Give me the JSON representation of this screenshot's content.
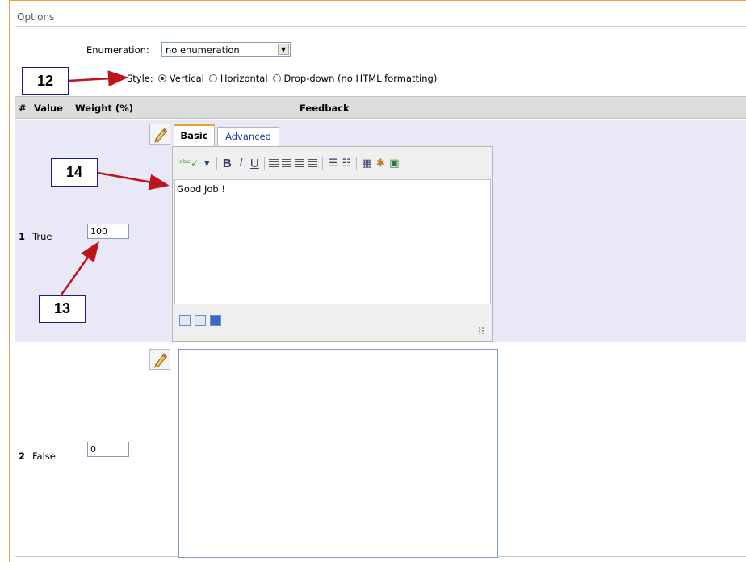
{
  "options": {
    "title": "Options",
    "enumeration_label": "Enumeration:",
    "enumeration_value": "no enumeration",
    "style_label": "Style:",
    "style_options": [
      "Vertical",
      "Horizontal",
      "Drop-down (no HTML formatting)"
    ],
    "style_selected": "Vertical"
  },
  "table": {
    "headers": {
      "num": "#",
      "value": "Value",
      "weight": "Weight (%)",
      "feedback": "Feedback"
    },
    "rows": [
      {
        "num": "1",
        "value": "True",
        "weight": "100",
        "feedback": "Good Job !"
      },
      {
        "num": "2",
        "value": "False",
        "weight": "0",
        "feedback": ""
      }
    ]
  },
  "editor": {
    "tabs": [
      "Basic",
      "Advanced"
    ],
    "active_tab": "Basic",
    "toolbar_icons": [
      "spellcheck-icon",
      "bold-icon",
      "italic-icon",
      "underline-icon",
      "align-left-icon",
      "align-center-icon",
      "align-right-icon",
      "align-justify-icon",
      "bullet-list-icon",
      "numbered-list-icon",
      "table-icon",
      "link-icon",
      "image-icon"
    ],
    "bottom_icons": [
      "new-document-icon",
      "preview-icon",
      "fullscreen-icon"
    ]
  },
  "callouts": {
    "c12": "12",
    "c13": "13",
    "c14": "14"
  },
  "colors": {
    "frame_border": "#f0a040",
    "row_highlight": "#e8e8f6",
    "arrow": "#c0141c",
    "tab_accent": "#f0a030",
    "link": "#1a3aa8"
  }
}
